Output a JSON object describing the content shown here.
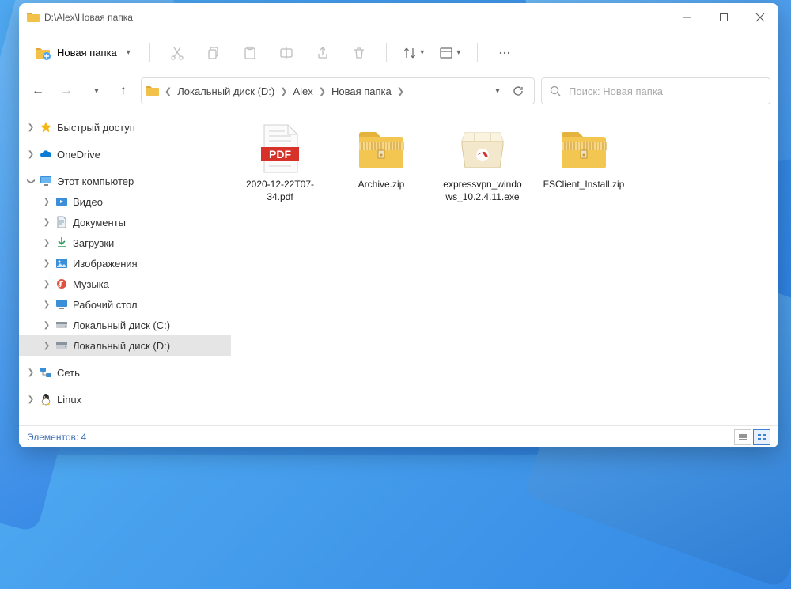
{
  "title": "D:\\Alex\\Новая папка",
  "toolbar": {
    "new_label": "Новая папка"
  },
  "breadcrumb": {
    "items": [
      "Локальный диск (D:)",
      "Alex",
      "Новая папка"
    ]
  },
  "search": {
    "placeholder": "Поиск: Новая папка"
  },
  "sidebar": {
    "quick_access": "Быстрый доступ",
    "onedrive": "OneDrive",
    "this_pc": "Этот компьютер",
    "videos": "Видео",
    "documents": "Документы",
    "downloads": "Загрузки",
    "pictures": "Изображения",
    "music": "Музыка",
    "desktop": "Рабочий стол",
    "disk_c": "Локальный диск (C:)",
    "disk_d": "Локальный диск (D:)",
    "network": "Сеть",
    "linux": "Linux"
  },
  "files": [
    {
      "name": "2020-12-22T07-34.pdf",
      "type": "pdf"
    },
    {
      "name": "Archive.zip",
      "type": "zip"
    },
    {
      "name": "expressvpn_windows_10.2.4.11.exe",
      "type": "exe"
    },
    {
      "name": "FSClient_Install.zip",
      "type": "zip"
    }
  ],
  "status": {
    "count_label": "Элементов: 4"
  }
}
